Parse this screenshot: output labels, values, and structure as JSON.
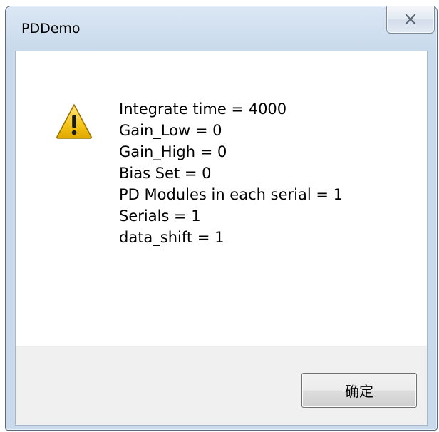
{
  "window": {
    "title": "PDDemo",
    "close_glyph": "x"
  },
  "dialog": {
    "icon": "warning-icon",
    "lines": [
      "Integrate time = 4000",
      "Gain_Low = 0",
      "Gain_High = 0",
      "Bias Set = 0",
      "PD Modules in each serial = 1",
      "Serials = 1",
      "data_shift = 1"
    ],
    "ok_label": "确定"
  },
  "colors": {
    "frame": "#c9daec",
    "footer": "#f0f0f0",
    "warning_fill": "#f5c518"
  }
}
